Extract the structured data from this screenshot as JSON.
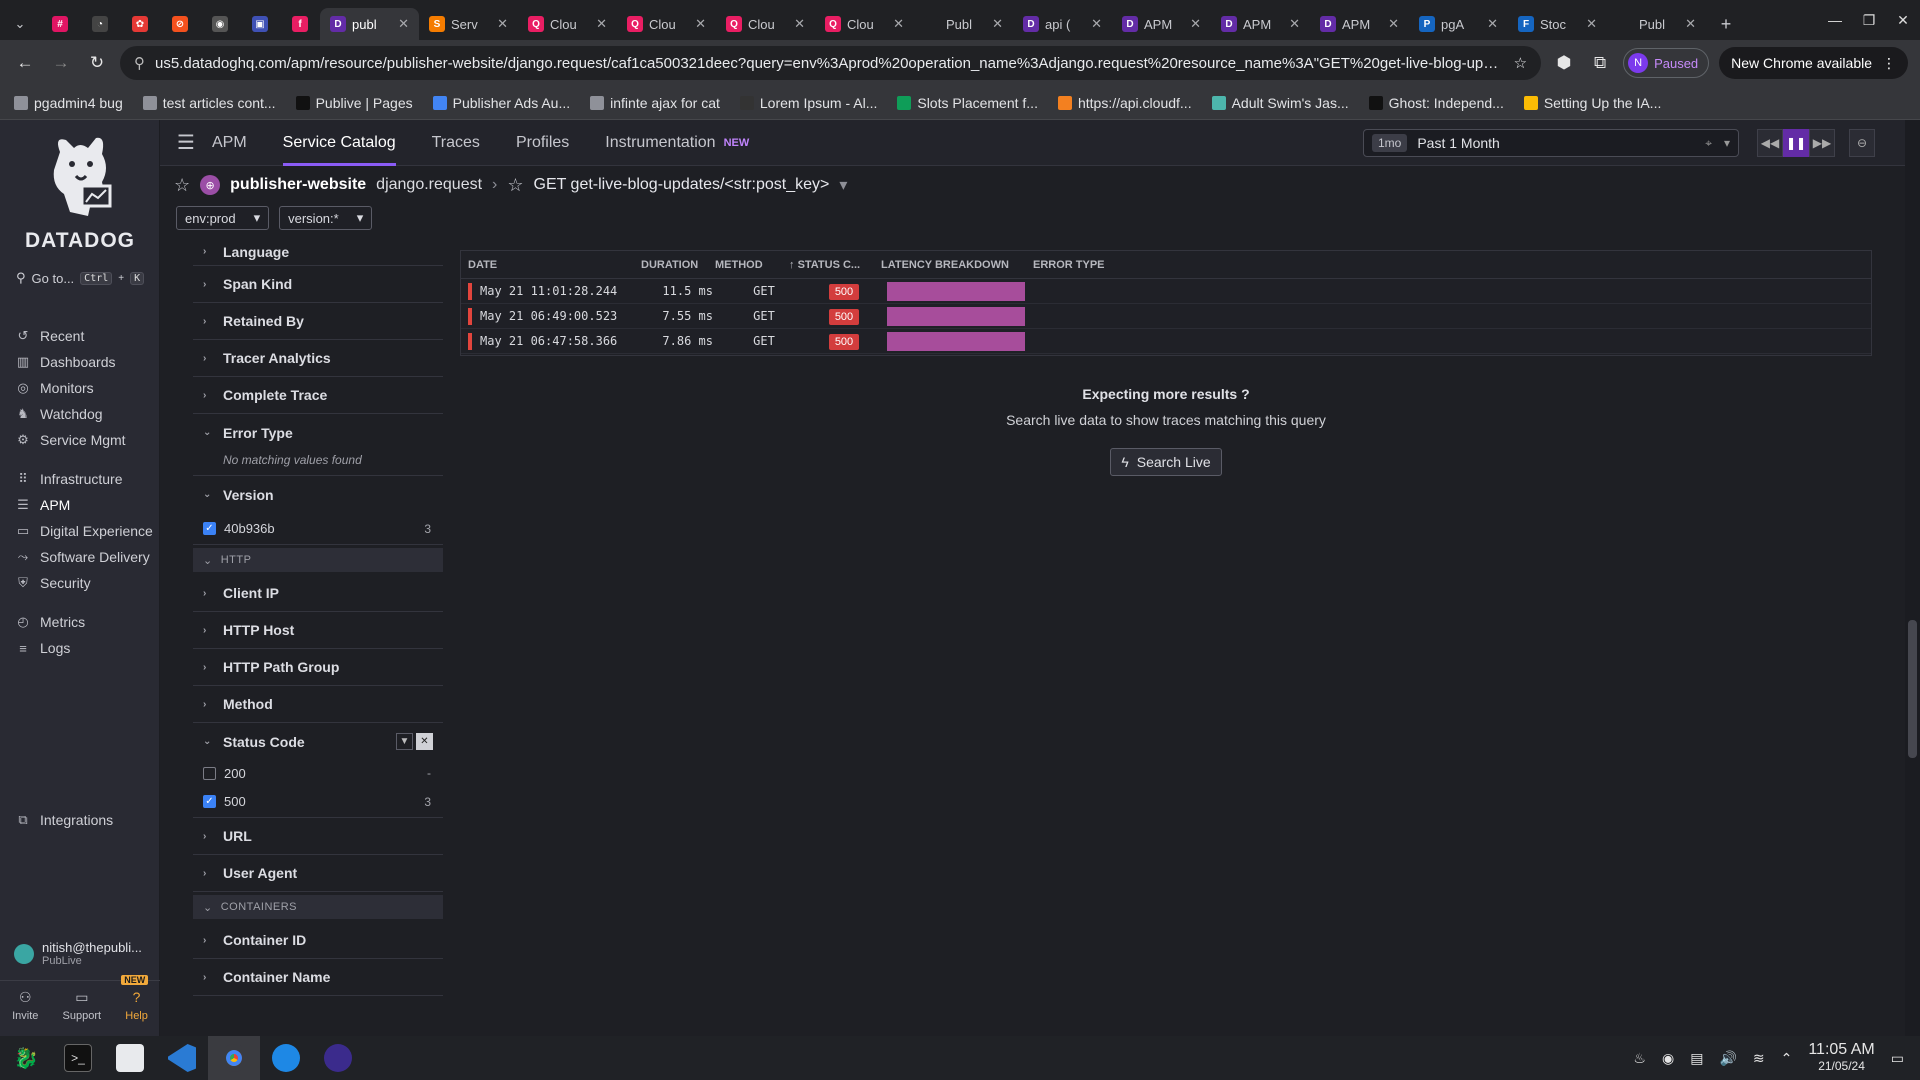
{
  "browser": {
    "tabs": [
      {
        "label": "",
        "color": "#e01563",
        "glyph": "#"
      },
      {
        "label": "",
        "color": "#444",
        "glyph": "◔"
      },
      {
        "label": "",
        "color": "#e53935",
        "glyph": "✿"
      },
      {
        "label": "",
        "color": "#f4511e",
        "glyph": "⊘"
      },
      {
        "label": "",
        "color": "#555",
        "glyph": "◉"
      },
      {
        "label": "",
        "color": "#3f51b5",
        "glyph": "▣"
      },
      {
        "label": "",
        "color": "#e91e63",
        "glyph": "f"
      },
      {
        "label": "publ",
        "color": "#632ca6",
        "glyph": "D",
        "active": true
      },
      {
        "label": "Serv",
        "color": "#f57c00",
        "glyph": "S"
      },
      {
        "label": "Clou",
        "color": "#e91e63",
        "glyph": "Q"
      },
      {
        "label": "Clou",
        "color": "#e91e63",
        "glyph": "Q"
      },
      {
        "label": "Clou",
        "color": "#e91e63",
        "glyph": "Q"
      },
      {
        "label": "Clou",
        "color": "#e91e63",
        "glyph": "Q"
      },
      {
        "label": "Publ",
        "color": "#202124",
        "glyph": ""
      },
      {
        "label": "api (",
        "color": "#632ca6",
        "glyph": "D"
      },
      {
        "label": "APM",
        "color": "#632ca6",
        "glyph": "D"
      },
      {
        "label": "APM",
        "color": "#632ca6",
        "glyph": "D"
      },
      {
        "label": "APM",
        "color": "#632ca6",
        "glyph": "D"
      },
      {
        "label": "pgA",
        "color": "#1565c0",
        "glyph": "P"
      },
      {
        "label": "Stoc",
        "color": "#1565c0",
        "glyph": "F"
      },
      {
        "label": "Publ",
        "color": "#202124",
        "glyph": ""
      }
    ],
    "url": "us5.datadoghq.com/apm/resource/publisher-website/django.request/caf1ca500321deec?query=env%3Aprod%20operation_name%3Adjango.request%20resource_name%3A\"GET%20get-live-blog-upd...",
    "profile_initial": "N",
    "profile_status": "Paused",
    "update_label": "New Chrome available",
    "bookmarks": [
      {
        "label": "pgadmin4 bug",
        "color": "#8f9199"
      },
      {
        "label": "test articles cont...",
        "color": "#8f9199"
      },
      {
        "label": "Publive | Pages",
        "color": "#111"
      },
      {
        "label": "Publisher Ads Au...",
        "color": "#4285f4"
      },
      {
        "label": "infinte ajax for cat",
        "color": "#8f9199"
      },
      {
        "label": "Lorem Ipsum - Al...",
        "color": "#333"
      },
      {
        "label": "Slots Placement f...",
        "color": "#0f9d58"
      },
      {
        "label": "https://api.cloudf...",
        "color": "#f38020"
      },
      {
        "label": "Adult Swim's Jas...",
        "color": "#4db6ac"
      },
      {
        "label": "Ghost: Independ...",
        "color": "#111"
      },
      {
        "label": "Setting Up the IA...",
        "color": "#fbbc04"
      }
    ]
  },
  "sidebar": {
    "logo_text": "DATADOG",
    "goto_label": "Go to...",
    "goto_keys": [
      "Ctrl",
      "K"
    ],
    "items": [
      {
        "label": "Recent",
        "icon": "clock-icon",
        "glyph": "↺"
      },
      {
        "label": "Dashboards",
        "icon": "chart-icon",
        "glyph": "▥"
      },
      {
        "label": "Monitors",
        "icon": "monitor-icon",
        "glyph": "◎"
      },
      {
        "label": "Watchdog",
        "icon": "dog-icon",
        "glyph": "♞"
      },
      {
        "label": "Service Mgmt",
        "icon": "gear-icon",
        "glyph": "⚙"
      },
      {
        "label": "Infrastructure",
        "icon": "nodes-icon",
        "glyph": "⠿"
      },
      {
        "label": "APM",
        "icon": "list-icon",
        "glyph": "☰",
        "selected": true
      },
      {
        "label": "Digital Experience",
        "icon": "screen-icon",
        "glyph": "▭"
      },
      {
        "label": "Software Delivery",
        "icon": "ci-icon",
        "glyph": "⤳"
      },
      {
        "label": "Security",
        "icon": "shield-icon",
        "glyph": "⛨"
      },
      {
        "label": "Metrics",
        "icon": "metrics-icon",
        "glyph": "◴"
      },
      {
        "label": "Logs",
        "icon": "logs-icon",
        "glyph": "≡"
      },
      {
        "label": "Integrations",
        "icon": "puzzle-icon",
        "glyph": "⧉"
      }
    ],
    "user_name": "nitish@thepubli...",
    "user_org": "PubLive",
    "bottom": {
      "invite": "Invite",
      "support": "Support",
      "help": "Help",
      "help_badge": "NEW"
    }
  },
  "topnav": {
    "section": "APM",
    "tabs": [
      "Service Catalog",
      "Traces",
      "Profiles",
      "Instrumentation"
    ],
    "instrumentation_badge": "NEW",
    "time_chip": "1mo",
    "time_label": "Past 1 Month"
  },
  "breadcrumb": {
    "service": "publisher-website",
    "operation": "django.request",
    "resource": "GET get-live-blog-updates/<str:post_key>"
  },
  "filters": {
    "env": "env:prod",
    "version": "version:*"
  },
  "facets": {
    "language": "Language",
    "span_kind": "Span Kind",
    "retained_by": "Retained By",
    "tracer_analytics": "Tracer Analytics",
    "complete_trace": "Complete Trace",
    "error_type": "Error Type",
    "error_type_empty": "No matching values found",
    "version": "Version",
    "version_value": "40b936b",
    "version_count": "3",
    "group_http": "HTTP",
    "client_ip": "Client IP",
    "http_host": "HTTP Host",
    "http_path_group": "HTTP Path Group",
    "method": "Method",
    "status_code": "Status Code",
    "status_200": "200",
    "status_200_count": "-",
    "status_500": "500",
    "status_500_count": "3",
    "url": "URL",
    "user_agent": "User Agent",
    "group_containers": "CONTAINERS",
    "container_id": "Container ID",
    "container_name": "Container Name"
  },
  "table": {
    "headers": {
      "date": "DATE",
      "duration": "DURATION",
      "method": "METHOD",
      "status": "STATUS C...",
      "latency": "LATENCY BREAKDOWN",
      "error": "ERROR TYPE"
    },
    "rows": [
      {
        "date": "May 21 11:01:28.244",
        "duration": "11.5 ms",
        "method": "GET",
        "status": "500"
      },
      {
        "date": "May 21 06:49:00.523",
        "duration": "7.55 ms",
        "method": "GET",
        "status": "500"
      },
      {
        "date": "May 21 06:47:58.366",
        "duration": "7.86 ms",
        "method": "GET",
        "status": "500"
      }
    ]
  },
  "empty_state": {
    "title": "Expecting more results ?",
    "subtitle": "Search live data to show traces matching this query",
    "button": "Search Live"
  },
  "taskbar": {
    "time": "11:05 AM",
    "date": "21/05/24"
  }
}
